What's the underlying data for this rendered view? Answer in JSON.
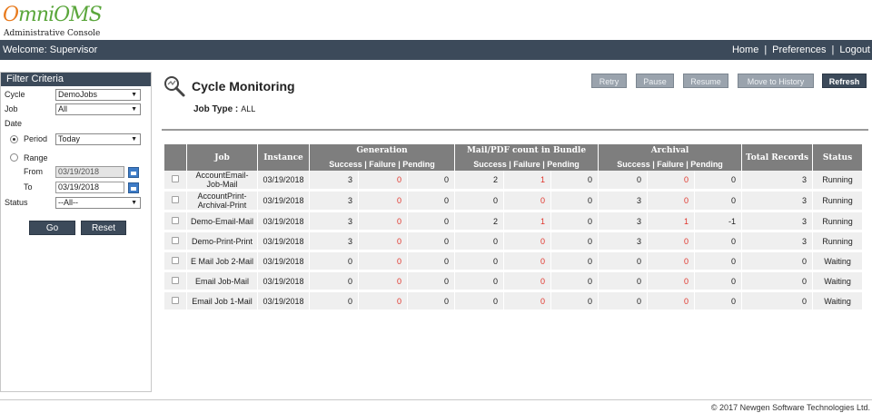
{
  "app": {
    "logo_o": "O",
    "logo_rest": "mniOMS",
    "subtitle": "Administrative Console"
  },
  "topbar": {
    "welcome": "Welcome: Supervisor",
    "nav": [
      "Home",
      "Preferences",
      "Logout"
    ],
    "separator": "|",
    "color": "#3c4a5a"
  },
  "filter": {
    "title": "Filter Criteria",
    "cycle_label": "Cycle",
    "cycle_value": "DemoJobs",
    "job_label": "Job",
    "job_value": "All",
    "date_label": "Date",
    "period_label": "Period",
    "period_value": "Today",
    "period_selected": true,
    "range_label": "Range",
    "from_label": "From",
    "from_value": "03/19/2018",
    "to_label": "To",
    "to_value": "03/19/2018",
    "status_label": "Status",
    "status_value": "--All--",
    "go_label": "Go",
    "reset_label": "Reset"
  },
  "page": {
    "title": "Cycle Monitoring",
    "job_type_label": "Job Type :",
    "job_type_value": "ALL",
    "icon": "search-magnifier-icon"
  },
  "actions": {
    "retry": "Retry",
    "pause": "Pause",
    "resume": "Resume",
    "move_to_history": "Move to History",
    "refresh": "Refresh"
  },
  "table": {
    "headers": {
      "job": "Job",
      "instance": "Instance",
      "generation": "Generation",
      "mail_pdf": "Mail/PDF count in Bundle",
      "archival": "Archival",
      "total": "Total Records",
      "status": "Status"
    },
    "sub_headers": {
      "generation": "Success  |  Failure  |  Pending",
      "mail_pdf": "Success  |  Failure  |  Pending",
      "archival": "Success  |  Failure  |  Pending"
    },
    "rows": [
      {
        "job": "AccountEmail-Job-Mail",
        "instance": "03/19/2018",
        "gen_s": "3",
        "gen_f": "0",
        "gen_p": "0",
        "mail_s": "2",
        "mail_f": "1",
        "mail_p": "0",
        "arc_s": "0",
        "arc_f": "0",
        "arc_p": "0",
        "total": "3",
        "status": "Running"
      },
      {
        "job": "AccountPrint-Archival-Print",
        "instance": "03/19/2018",
        "gen_s": "3",
        "gen_f": "0",
        "gen_p": "0",
        "mail_s": "0",
        "mail_f": "0",
        "mail_p": "0",
        "arc_s": "3",
        "arc_f": "0",
        "arc_p": "0",
        "total": "3",
        "status": "Running"
      },
      {
        "job": "Demo-Email-Mail",
        "instance": "03/19/2018",
        "gen_s": "3",
        "gen_f": "0",
        "gen_p": "0",
        "mail_s": "2",
        "mail_f": "1",
        "mail_p": "0",
        "arc_s": "3",
        "arc_f": "1",
        "arc_p": "-1",
        "total": "3",
        "status": "Running"
      },
      {
        "job": "Demo-Print-Print",
        "instance": "03/19/2018",
        "gen_s": "3",
        "gen_f": "0",
        "gen_p": "0",
        "mail_s": "0",
        "mail_f": "0",
        "mail_p": "0",
        "arc_s": "3",
        "arc_f": "0",
        "arc_p": "0",
        "total": "3",
        "status": "Running"
      },
      {
        "job": "E Mail Job 2-Mail",
        "instance": "03/19/2018",
        "gen_s": "0",
        "gen_f": "0",
        "gen_p": "0",
        "mail_s": "0",
        "mail_f": "0",
        "mail_p": "0",
        "arc_s": "0",
        "arc_f": "0",
        "arc_p": "0",
        "total": "0",
        "status": "Waiting"
      },
      {
        "job": "Email Job-Mail",
        "instance": "03/19/2018",
        "gen_s": "0",
        "gen_f": "0",
        "gen_p": "0",
        "mail_s": "0",
        "mail_f": "0",
        "mail_p": "0",
        "arc_s": "0",
        "arc_f": "0",
        "arc_p": "0",
        "total": "0",
        "status": "Waiting"
      },
      {
        "job": "Email Job 1-Mail",
        "instance": "03/19/2018",
        "gen_s": "0",
        "gen_f": "0",
        "gen_p": "0",
        "mail_s": "0",
        "mail_f": "0",
        "mail_p": "0",
        "arc_s": "0",
        "arc_f": "0",
        "arc_p": "0",
        "total": "0",
        "status": "Waiting"
      }
    ],
    "failure_color": "#e0332a"
  },
  "footer": {
    "copyright": "© 2017 Newgen Software Technologies Ltd."
  }
}
